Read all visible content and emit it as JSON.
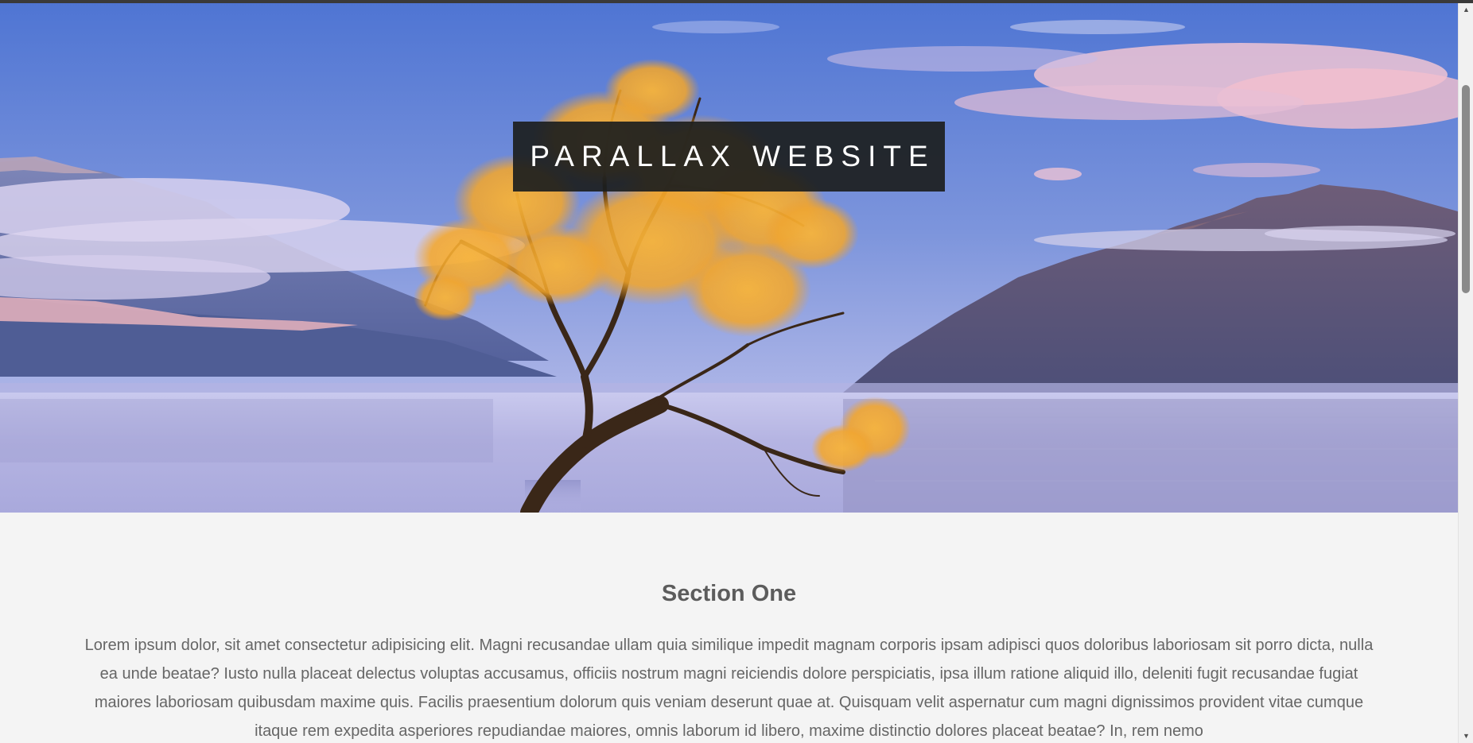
{
  "hero": {
    "title": "PARALLAX WEBSITE",
    "image_name": "lake-tree-landscape"
  },
  "section_one": {
    "heading": "Section One",
    "paragraph": "Lorem ipsum dolor, sit amet consectetur adipisicing elit. Magni recusandae ullam quia similique impedit magnam corporis ipsam adipisci quos doloribus laboriosam sit porro dicta, nulla ea unde beatae? Iusto nulla placeat delectus voluptas accusamus, officiis nostrum magni reiciendis dolore perspiciatis, ipsa illum ratione aliquid illo, deleniti fugit recusandae fugiat maiores laboriosam quibusdam maxime quis. Facilis praesentium dolorum quis veniam deserunt quae at. Quisquam velit aspernatur cum magni dignissimos provident vitae cumque itaque rem expedita asperiores repudiandae maiores, omnis laborum id libero, maxime distinctio dolores placeat beatae? In, rem nemo"
  },
  "scrollbar": {
    "up_icon": "scroll-up-arrow",
    "down_icon": "scroll-down-arrow"
  },
  "colors": {
    "page_background": "#f4f4f4",
    "title_box": "#1c1e1e",
    "heading_text": "#5c5c5c",
    "body_text": "#666666"
  }
}
